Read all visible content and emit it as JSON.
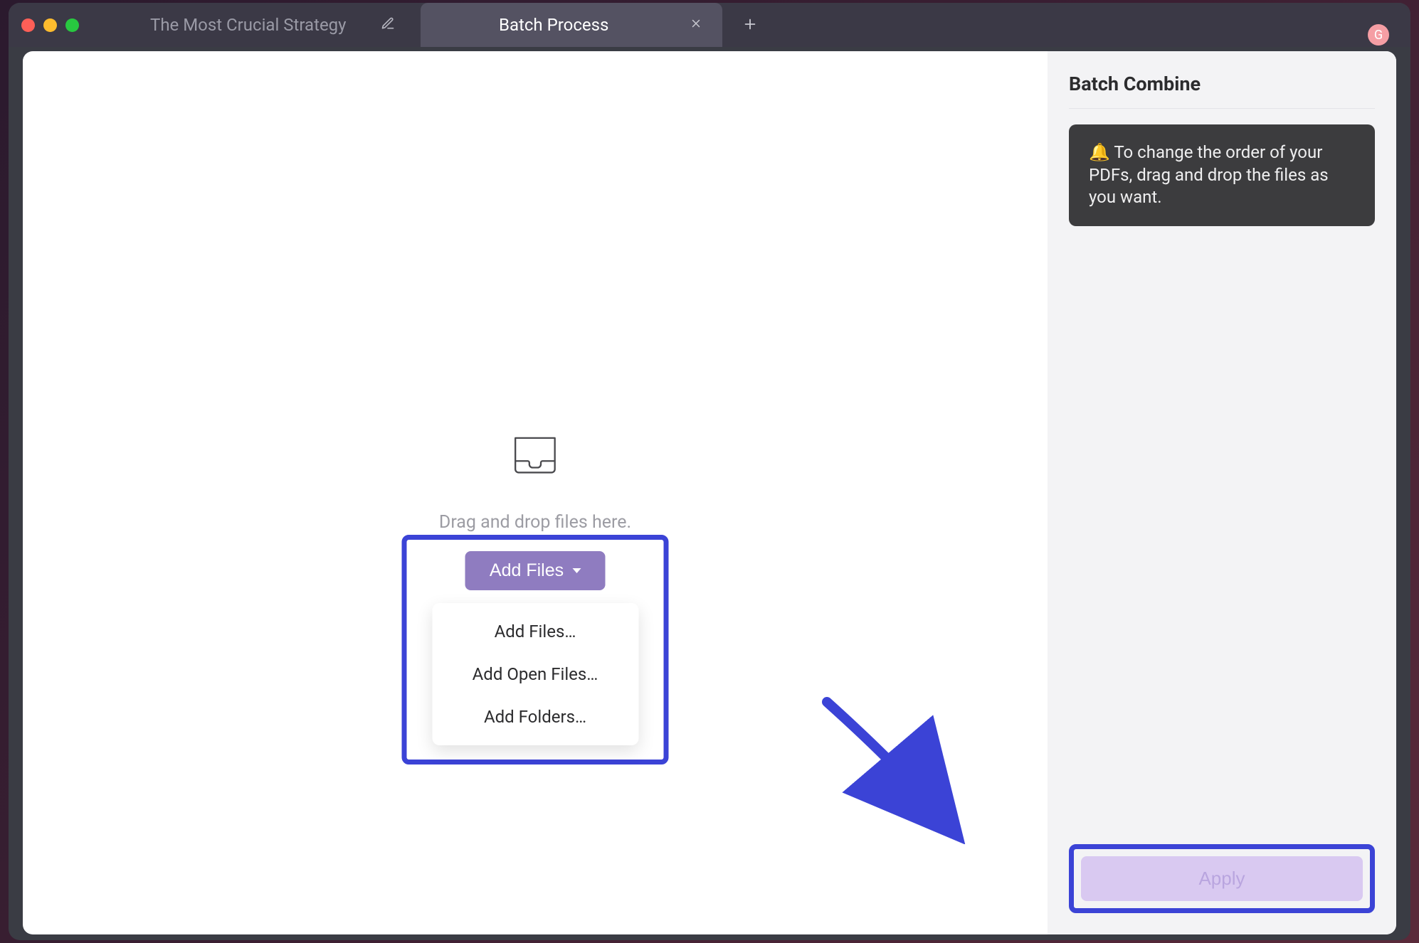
{
  "tabs": {
    "inactive_label": "The Most Crucial Strategy",
    "active_label": "Batch Process"
  },
  "avatar_letter": "G",
  "main": {
    "drop_hint": "Drag and drop files here.",
    "add_files_label": "Add Files",
    "menu_items": [
      "Add Files…",
      "Add Open Files…",
      "Add Folders…"
    ]
  },
  "sidebar": {
    "title": "Batch Combine",
    "tip": "🔔 To change the order of your PDFs, drag and drop the files as you want.",
    "apply_label": "Apply"
  }
}
